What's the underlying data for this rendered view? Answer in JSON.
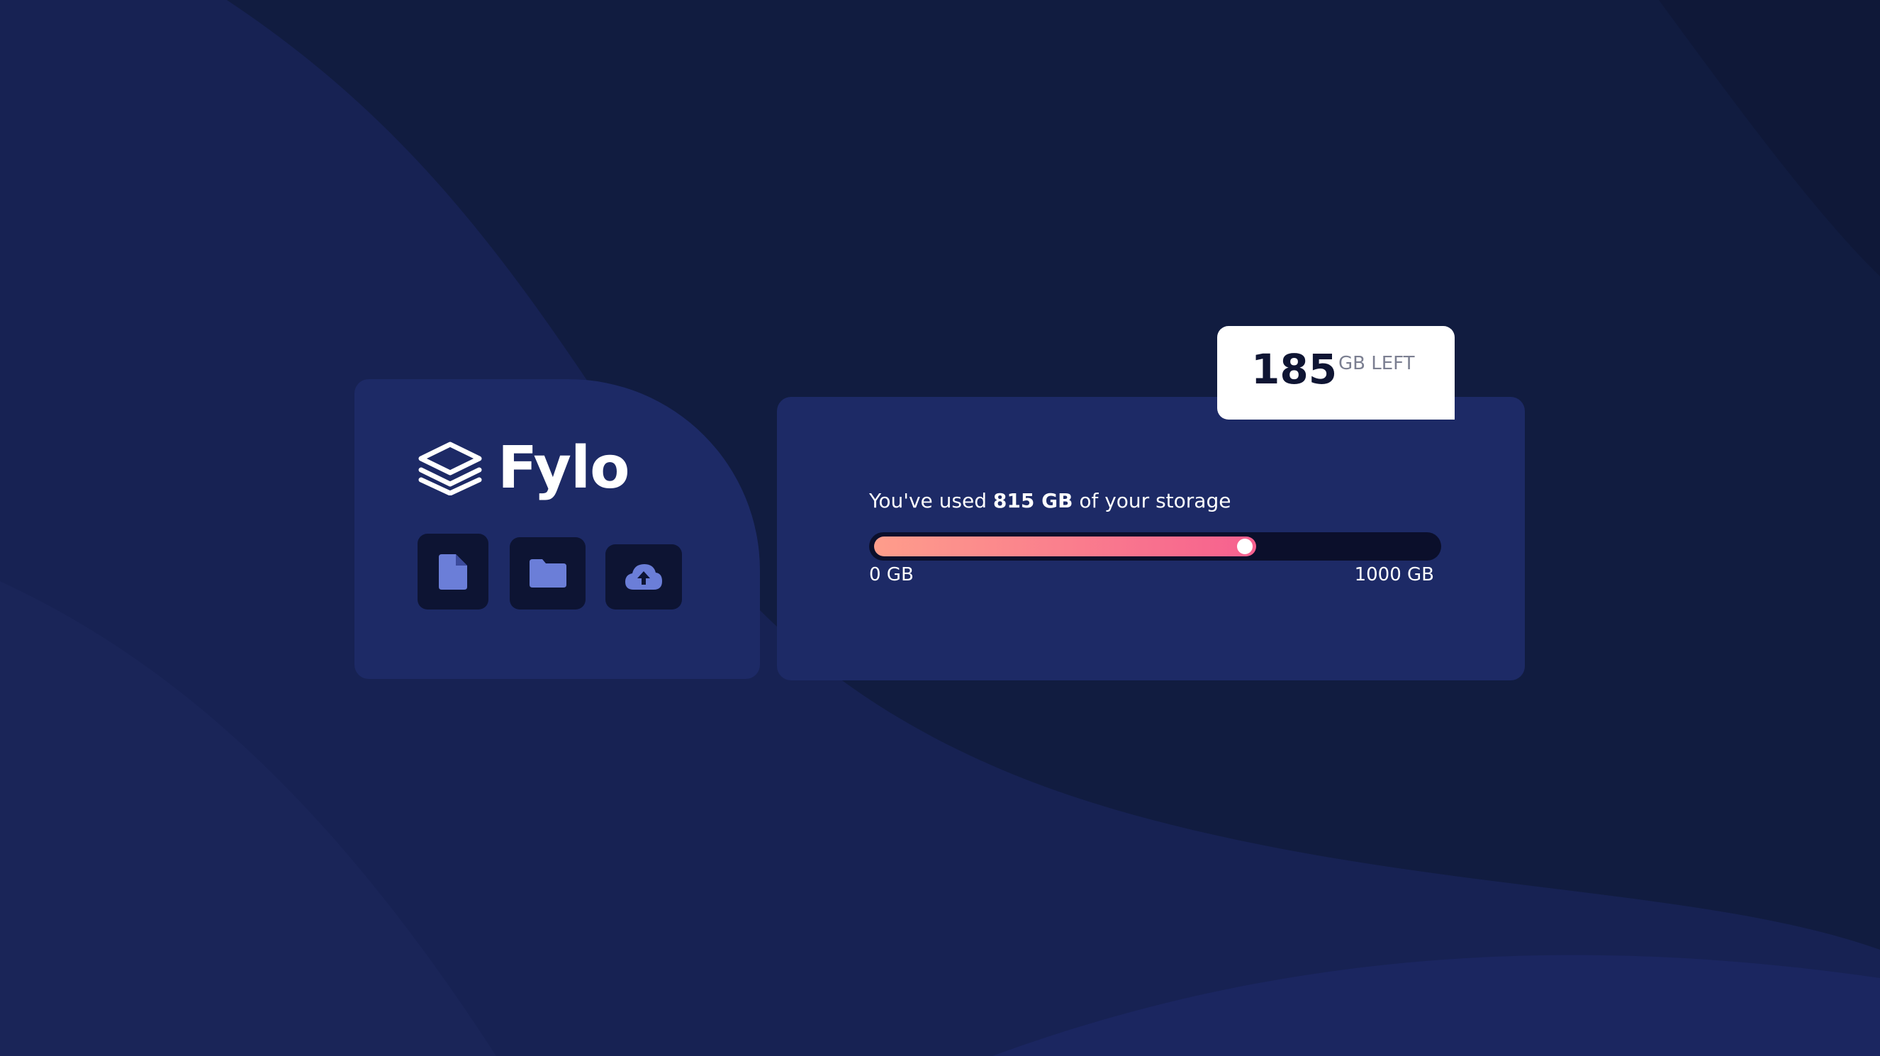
{
  "app": {
    "name": "Fylo"
  },
  "toolbar": {
    "buttons": [
      {
        "icon": "document-icon"
      },
      {
        "icon": "folder-icon"
      },
      {
        "icon": "upload-icon"
      }
    ]
  },
  "storage": {
    "used_prefix": "You've used ",
    "used_amount": "815 GB",
    "used_suffix": " of your storage",
    "min_label": "0 GB",
    "max_label": "1000 GB",
    "used_fraction": 0.68
  },
  "remaining": {
    "value": "185",
    "unit": "GB LEFT"
  },
  "colors": {
    "background": "#111c40",
    "card": "#1d2a66",
    "icon_tile": "#0d1433",
    "icon_accent": "#6b7ed8",
    "gradient_start": "#fe9d8b",
    "gradient_end": "#f6608f"
  }
}
